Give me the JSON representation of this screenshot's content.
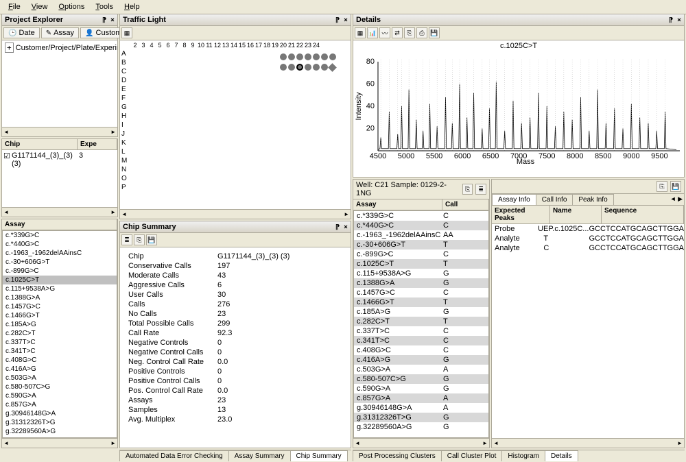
{
  "menu": {
    "file": "File",
    "view": "View",
    "options": "Options",
    "tools": "Tools",
    "help": "Help"
  },
  "panels": {
    "project_explorer": "Project Explorer",
    "traffic_light": "Traffic Light",
    "details": "Details",
    "chip_summary": "Chip Summary",
    "assay": "Assay"
  },
  "pe_tabs": {
    "date": "Date",
    "assay": "Assay",
    "customer": "Customer"
  },
  "pe_tree_root": "Customer/Project/Plate/Experim",
  "chip_table": {
    "headers": [
      "Chip",
      "Expe"
    ],
    "row": {
      "chip": "G1171144_(3)_(3) (3)",
      "expe": "3"
    }
  },
  "assay_list": [
    "c.*339G>C",
    "c.*440G>C",
    "c.-1963_-1962delAAinsC",
    "c.-30+606G>T",
    "c.-899G>C",
    "c.1025C>T",
    "c.115+9538A>G",
    "c.1388G>A",
    "c.1457G>C",
    "c.1466G>T",
    "c.185A>G",
    "c.282C>T",
    "c.337T>C",
    "c.341T>C",
    "c.408G>C",
    "c.416A>G",
    "c.503G>A",
    "c.580-507C>G",
    "c.590G>A",
    "c.857G>A",
    "g.30946148G>A",
    "g.31312326T>G",
    "g.32289560A>G"
  ],
  "assay_sel_idx": 5,
  "traffic": {
    "cols": [
      "2",
      "3",
      "4",
      "5",
      "6",
      "7",
      "8",
      "9",
      "10",
      "11",
      "12",
      "13",
      "14",
      "15",
      "16",
      "17",
      "18",
      "19",
      "20",
      "21",
      "22",
      "23",
      "24"
    ],
    "rows": [
      "A",
      "B",
      "C",
      "D",
      "E",
      "F",
      "G",
      "H",
      "I",
      "J",
      "K",
      "L",
      "M",
      "N",
      "O",
      "P"
    ]
  },
  "chip_summary": {
    "Chip": "G1171144_(3)_(3) (3)",
    "Conservative Calls": "197",
    "Moderate Calls": "43",
    "Aggressive Calls": "6",
    "User Calls": "30",
    "Calls": "276",
    "No Calls": "23",
    "Total Possible Calls": "299",
    "Call Rate": "92.3",
    "Negative Controls": "0",
    "Negative Control Calls": "0",
    "Neg. Control Call Rate": "0.0",
    "Positive Controls": "0",
    "Positive Control Calls": "0",
    "Pos. Control Call Rate": "0.0",
    "Assays": "23",
    "Samples": "13",
    "Avg. Multiplex": "23.0"
  },
  "well_label": "Well: C21 Sample: 0129-2-1NG",
  "assay_call": {
    "headers": [
      "Assay",
      "Call"
    ],
    "rows": [
      [
        "c.*339G>C",
        "C"
      ],
      [
        "c.*440G>C",
        "C"
      ],
      [
        "c.-1963_-1962delAAinsC",
        "AA"
      ],
      [
        "c.-30+606G>T",
        "T"
      ],
      [
        "c.-899G>C",
        "C"
      ],
      [
        "c.1025C>T",
        "T"
      ],
      [
        "c.115+9538A>G",
        "G"
      ],
      [
        "c.1388G>A",
        "G"
      ],
      [
        "c.1457G>C",
        "C"
      ],
      [
        "c.1466G>T",
        "T"
      ],
      [
        "c.185A>G",
        "G"
      ],
      [
        "c.282C>T",
        "T"
      ],
      [
        "c.337T>C",
        "C"
      ],
      [
        "c.341T>C",
        "C"
      ],
      [
        "c.408G>C",
        "C"
      ],
      [
        "c.416A>G",
        "G"
      ],
      [
        "c.503G>A",
        "A"
      ],
      [
        "c.580-507C>G",
        "G"
      ],
      [
        "c.590G>A",
        "G"
      ],
      [
        "c.857G>A",
        "A"
      ],
      [
        "g.30946148G>A",
        "A"
      ],
      [
        "g.31312326T>G",
        "G"
      ],
      [
        "g.32289560A>G",
        "G"
      ]
    ]
  },
  "info_tabs": [
    "Assay Info",
    "Call Info",
    "Peak Info"
  ],
  "info_table": {
    "headers": [
      "Expected Peaks",
      "Name",
      "Sequence"
    ],
    "rows": [
      [
        "Probe",
        "UEP.c.1025C...",
        "GCCTCCATGCAGCTTGGA"
      ],
      [
        "Analyte",
        "T",
        "GCCTCCATGCAGCTTGGA"
      ],
      [
        "Analyte",
        "C",
        "GCCTCCATGCAGCTTGGA"
      ]
    ]
  },
  "bottom_tabs": [
    "Automated Data Error Checking",
    "Assay Summary",
    "Chip Summary"
  ],
  "bottom_tabs_right": [
    "Post Processing Clusters",
    "Call Cluster Plot",
    "Histogram",
    "Details"
  ],
  "chart_data": {
    "type": "line",
    "title": "c.1025C>T",
    "xlabel": "Mass",
    "ylabel": "Intensity",
    "xlim": [
      4500,
      9800
    ],
    "ylim": [
      0,
      80
    ],
    "xticks": [
      4500,
      5000,
      5500,
      6000,
      6500,
      7000,
      7500,
      8000,
      8500,
      9000,
      9500
    ],
    "yticks": [
      20,
      40,
      60,
      80
    ],
    "peaks_mass": [
      4550,
      4700,
      4850,
      4920,
      5050,
      5180,
      5300,
      5420,
      5550,
      5700,
      5820,
      5950,
      6080,
      6200,
      6350,
      6480,
      6600,
      6750,
      6900,
      7050,
      7200,
      7350,
      7500,
      7650,
      7800,
      7950,
      8100,
      8250,
      8400,
      8550,
      8700,
      8850,
      9000,
      9150,
      9300,
      9450,
      9600
    ],
    "peaks_intensity": [
      12,
      35,
      15,
      40,
      55,
      28,
      18,
      42,
      22,
      48,
      25,
      60,
      30,
      52,
      20,
      38,
      62,
      18,
      45,
      25,
      30,
      52,
      40,
      22,
      35,
      28,
      48,
      18,
      55,
      25,
      38,
      20,
      42,
      30,
      25,
      18,
      35
    ]
  }
}
